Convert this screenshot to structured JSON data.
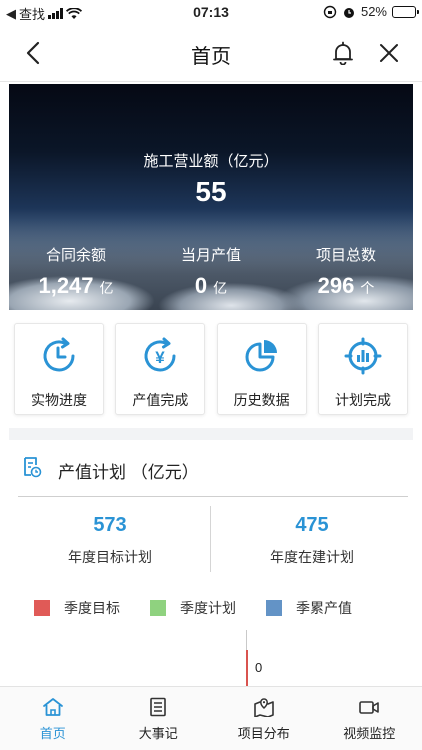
{
  "status_bar": {
    "back_app": "查找",
    "time": "07:13",
    "battery": "52%",
    "battery_level": 0.52
  },
  "navbar": {
    "title": "首页"
  },
  "hero": {
    "label": "施工营业额（亿元）",
    "value": "55",
    "stats": [
      {
        "label": "合同余额",
        "value": "1,247",
        "unit": "亿"
      },
      {
        "label": "当月产值",
        "value": "0",
        "unit": "亿"
      },
      {
        "label": "项目总数",
        "value": "296",
        "unit": "个"
      }
    ]
  },
  "cards": [
    {
      "label": "实物进度",
      "icon": "clock-progress-icon"
    },
    {
      "label": "产值完成",
      "icon": "yuan-refresh-icon"
    },
    {
      "label": "历史数据",
      "icon": "pie-chart-icon"
    },
    {
      "label": "计划完成",
      "icon": "target-bars-icon"
    }
  ],
  "section": {
    "title": "产值计划  （亿元）"
  },
  "plans": [
    {
      "value": "573",
      "label": "年度目标计划"
    },
    {
      "value": "475",
      "label": "年度在建计划"
    }
  ],
  "chart_data": {
    "type": "bar",
    "series": [
      {
        "name": "季度目标",
        "color": "#e05a57",
        "values": [
          0
        ]
      },
      {
        "name": "季度计划",
        "color": "#8fd27f",
        "values": []
      },
      {
        "name": "季累产值",
        "color": "#6393c6",
        "values": []
      }
    ],
    "data_labels": [
      "0"
    ]
  },
  "colors": {
    "accent": "#2a93d5"
  },
  "tabbar": [
    {
      "label": "首页",
      "icon": "home-icon",
      "active": true
    },
    {
      "label": "大事记",
      "icon": "list-icon",
      "active": false
    },
    {
      "label": "项目分布",
      "icon": "map-icon",
      "active": false
    },
    {
      "label": "视频监控",
      "icon": "video-camera-icon",
      "active": false
    }
  ]
}
